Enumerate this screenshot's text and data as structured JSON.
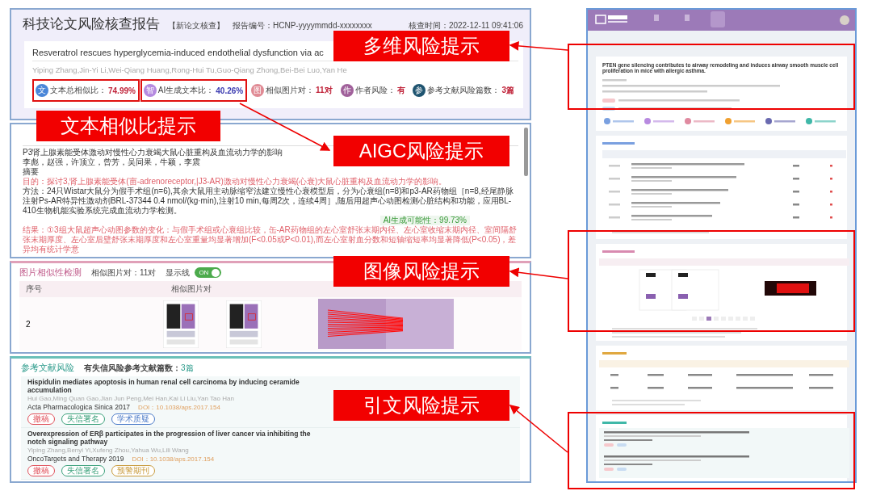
{
  "report": {
    "title": "科技论文风险核查报告",
    "tag": "【新论文核查】",
    "report_no": "报告编号：HCNP-yyyymmdd-xxxxxxxx",
    "check_time": "核查时间：2022-12-11 09:41:06",
    "paper_title": "Resveratrol rescues hyperglycemia-induced endothelial dysfunction via ac",
    "authors": "Yiping Zhang,Jin-Yi Li,Wei-Qiang Huang,Rong-Hui Tu,Guo-Qiang Zhong,Bei-Bei Luo,Yan He",
    "metrics": [
      {
        "icon": "文",
        "color": "#4a86d8",
        "label": "文本总相似比：",
        "value": "74.99%",
        "outlined": true
      },
      {
        "icon": "智",
        "color": "#b58ae0",
        "label": "AI生成文本比：",
        "value": "40.26%",
        "outlined": true
      },
      {
        "icon": "图",
        "color": "#e08a94",
        "label": "相似图片对：",
        "value": "11对",
        "outlined": false
      },
      {
        "icon": "作",
        "color": "#a0609a",
        "label": "作者风险：",
        "value": "有",
        "outlined": false
      },
      {
        "icon": "参",
        "color": "#1f5470",
        "label": "参考文献风险篇数：",
        "value": "3篇",
        "outlined": false
      }
    ]
  },
  "annotated_text": {
    "lines": [
      {
        "kind": "plain",
        "text": "P3肾上腺素能受体激动对慢性心力衰竭大鼠心脏重构及血流动力学的影响"
      },
      {
        "kind": "plain",
        "text": "李彪，赵强，许顶立，曾芳，吴同果，牛颖，李震"
      },
      {
        "kind": "plain",
        "text": "摘要"
      },
      {
        "kind": "flagged",
        "text": "目的：探讨3,肾上腺素能受体(亩-adrenoreceptor,|J3-AR)激动对慢性心力衰竭(心衰)大鼠心脏重构及血流动力学的影响。"
      },
      {
        "kind": "plain",
        "text": "方法：24只Wistar大鼠分为假手术组(n=6),其余大鼠用主动脉缩窄法建立慢性心衰模型后，分为心衰组(n=8)和p3-AR药物组［n=8,经尾静脉注射Ps-AR特异性激动剂BRL-37344 0.4 nmol/(kg·min),注射10 min,每周2次，连续4周］,随后用超声心动图检测心脏结构和功能，应用BL-410生物机能实验系统完成血流动力学检测。"
      },
      {
        "kind": "flagged",
        "text": "结果：①3组大鼠超声心动图参数的变化：与假手术组或心衰组比较，缶-AR药物组的左心室舒张末期内径、左心室收缩末期内径、室间隔舒张末期厚度、左心室后壁舒张末期厚度和左心室重量均显著增加(F<0.05或P<0.01),而左心室射血分数和短轴缩短率均显著降低(P<0.05)，差异均有统计学意"
      }
    ],
    "ai_tooltip": "AI生成可能性：99.73%"
  },
  "image_check": {
    "title": "图片相似性检测",
    "count": "相似图片对：11对",
    "toggle_label": "显示线",
    "toggle_text": "ON",
    "toggle_on": true,
    "columns": [
      "序号",
      "相似图片对"
    ],
    "rows": [
      {
        "index": "2"
      }
    ]
  },
  "references": {
    "title": "参考文献风险",
    "summary": "有失信风险参考文献篇数：",
    "count": "3篇",
    "items": [
      {
        "title": "Hispidulin mediates apoptosis in human renal cell carcinoma by inducing ceramide accumulation",
        "authors": "Hui Gao,Ming Quan Gao,Jian Jun Peng,Mei Han,Kai Li Liu,Yan Tao Han",
        "journal": "Acta Pharmacologica Sinica 2017",
        "doi": "DOI：10.1038/aps.2017.154",
        "tags": [
          {
            "text": "撤稿",
            "color": "#e0505a"
          },
          {
            "text": "失信署名",
            "color": "#3aa07a"
          },
          {
            "text": "学术质疑",
            "color": "#4a7ac8"
          }
        ]
      },
      {
        "title": "Overexpression of ERβ participates in the progression of liver cancer via inhibiting the notch signaling pathway",
        "authors": "Yiping Zhang,Benyi Yi,Xufeng Zhou,Yahua Wu,Lili Wang",
        "journal": "OncoTargets and Therapy 2019",
        "doi": "DOI：10.1038/aps.2017.154",
        "tags": [
          {
            "text": "撤稿",
            "color": "#e0505a"
          },
          {
            "text": "失信署名",
            "color": "#3aa07a"
          },
          {
            "text": "预警期刊",
            "color": "#c89a3a"
          }
        ]
      }
    ]
  },
  "overview": {
    "paper_title": "PTEN gene silencing contributes to airway remodeling and induces airway smooth muscle cell proliferation in mice with allergic asthma."
  },
  "callouts": [
    {
      "text": "多维风险提示"
    },
    {
      "text": "文本相似比提示"
    },
    {
      "text": "AIGC风险提示"
    },
    {
      "text": "图像风险提示"
    },
    {
      "text": "引文风险提示"
    }
  ]
}
